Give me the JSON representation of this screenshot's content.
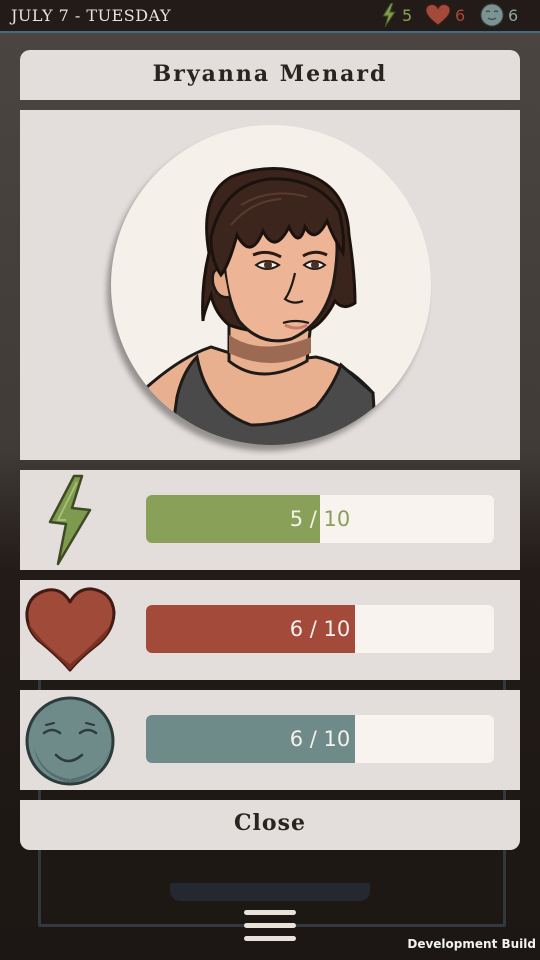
{
  "header": {
    "date": "JULY 7 - TUESDAY",
    "stats": {
      "energy": {
        "icon": "lightning-icon",
        "value": "5",
        "color": "#8aa05a"
      },
      "health": {
        "icon": "heart-icon",
        "value": "6",
        "color": "#a64a3a"
      },
      "mood": {
        "icon": "mood-face-icon",
        "value": "6",
        "color": "#8ea4a4"
      }
    }
  },
  "dialog": {
    "character_name": "Bryanna Menard",
    "portrait": "character-portrait",
    "stats": [
      {
        "key": "energy",
        "icon": "lightning-icon",
        "current": "5",
        "max": "10",
        "fraction": 0.5,
        "color": "#89a058"
      },
      {
        "key": "health",
        "icon": "heart-icon",
        "current": "6",
        "max": "10",
        "fraction": 0.6,
        "color": "#a34a3b"
      },
      {
        "key": "mood",
        "icon": "mood-face-icon",
        "current": "6",
        "max": "10",
        "fraction": 0.6,
        "color": "#6e8a89"
      }
    ],
    "close_label": "Close"
  },
  "footer": {
    "menu_icon": "hamburger-menu-icon",
    "build_label": "Development Build"
  },
  "colors": {
    "panel": "#e3dedb",
    "accent_line": "#3f6b86",
    "background": "#1c1714"
  }
}
